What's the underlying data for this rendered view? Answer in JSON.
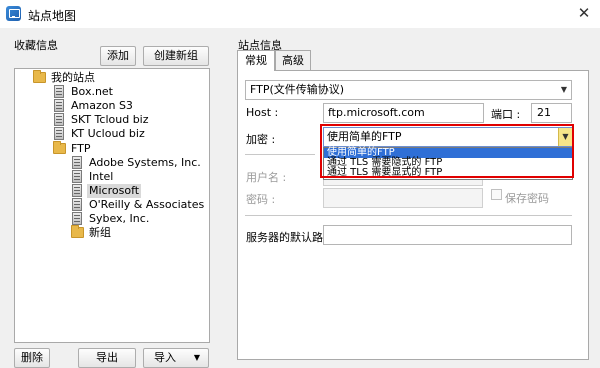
{
  "window": {
    "title": "站点地图",
    "close_glyph": "✕"
  },
  "favorites": {
    "label": "收藏信息",
    "add_button": "添加",
    "new_group_button": "创建新组",
    "tree": [
      {
        "label": "我的站点",
        "icon": "folder-icon",
        "level": 0
      },
      {
        "label": "Box.net",
        "icon": "server-icon",
        "level": 1
      },
      {
        "label": "Amazon S3",
        "icon": "server-icon",
        "level": 1
      },
      {
        "label": "SKT Tcloud biz",
        "icon": "server-icon",
        "level": 1
      },
      {
        "label": "KT Ucloud biz",
        "icon": "server-icon",
        "level": 1
      },
      {
        "label": "FTP",
        "icon": "folder-icon",
        "level": 1
      },
      {
        "label": "Adobe Systems, Inc.",
        "icon": "server-icon",
        "level": 2
      },
      {
        "label": "Intel",
        "icon": "server-icon",
        "level": 2
      },
      {
        "label": "Microsoft",
        "icon": "server-icon",
        "level": 2,
        "selected": true
      },
      {
        "label": "O'Reilly & Associates",
        "icon": "server-icon",
        "level": 2
      },
      {
        "label": "Sybex, Inc.",
        "icon": "server-icon",
        "level": 2
      },
      {
        "label": "新组",
        "icon": "folder-icon",
        "level": 2
      }
    ],
    "delete_button": "删除",
    "export_button": "导出",
    "import_button": "导入",
    "import_arrow": "▼"
  },
  "site": {
    "label": "站点信息",
    "tabs": [
      {
        "label": "常规",
        "active": true
      },
      {
        "label": "高级",
        "active": false
      }
    ],
    "protocol": "FTP(文件传输协议)",
    "dropdown_arrow": "▼",
    "host_label": "Host :",
    "host_value": "ftp.microsoft.com",
    "port_label": "端口 :",
    "port_value": "21",
    "encryption_label": "加密 :",
    "encryption_selected": "使用简单的FTP",
    "encryption_options": [
      {
        "label": "使用简单的FTP",
        "highlighted": true
      },
      {
        "label": "通过 TLS 需要隐式的 FTP",
        "highlighted": false
      },
      {
        "label": "通过 TLS 需要显式的 FTP",
        "highlighted": false
      }
    ],
    "username_label": "用户名 :",
    "password_label": "密码 :",
    "save_password_label": "保存密码",
    "default_path_label": "服务器的默认路径"
  }
}
